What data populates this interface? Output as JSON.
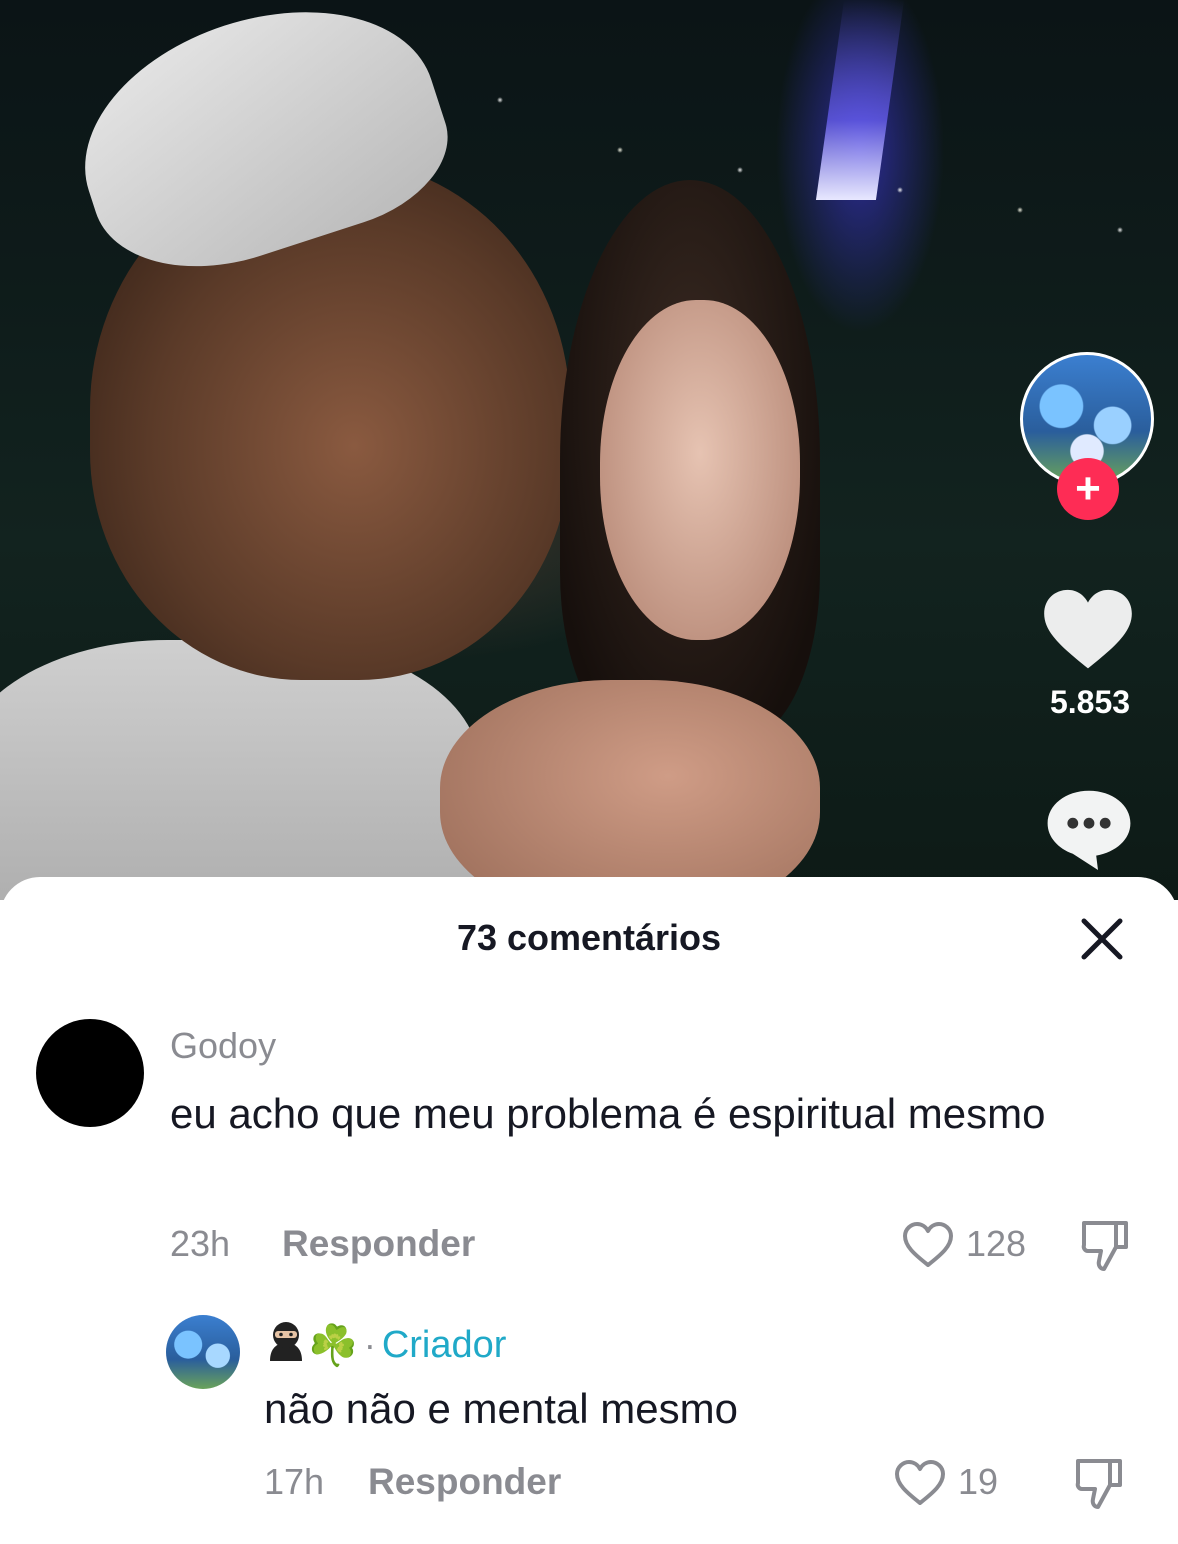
{
  "video": {
    "like_count": "5.853",
    "follow_glyph": "+"
  },
  "icons": {
    "like": "heart-icon",
    "comment": "comment-bubble-icon",
    "close": "close-icon",
    "comment_like": "heart-outline-icon",
    "comment_dislike": "thumbs-down-icon",
    "follow": "plus-icon"
  },
  "colors": {
    "follow_red": "#fe2c55",
    "creator_teal": "#20a9c8",
    "muted_gray": "#8a8b91",
    "text_dark": "#161823"
  },
  "comments_sheet": {
    "title": "73 comentários",
    "comments": [
      {
        "username": "Godoy",
        "text": "eu acho que meu problema é espiritual mesmo",
        "time": "23h",
        "reply_label": "Responder",
        "likes": "128"
      },
      {
        "username_clover": "☘️",
        "separator": "·",
        "badge": "Criador",
        "text": "não não e mental mesmo",
        "time": "17h",
        "reply_label": "Responder",
        "likes": "19"
      }
    ]
  }
}
